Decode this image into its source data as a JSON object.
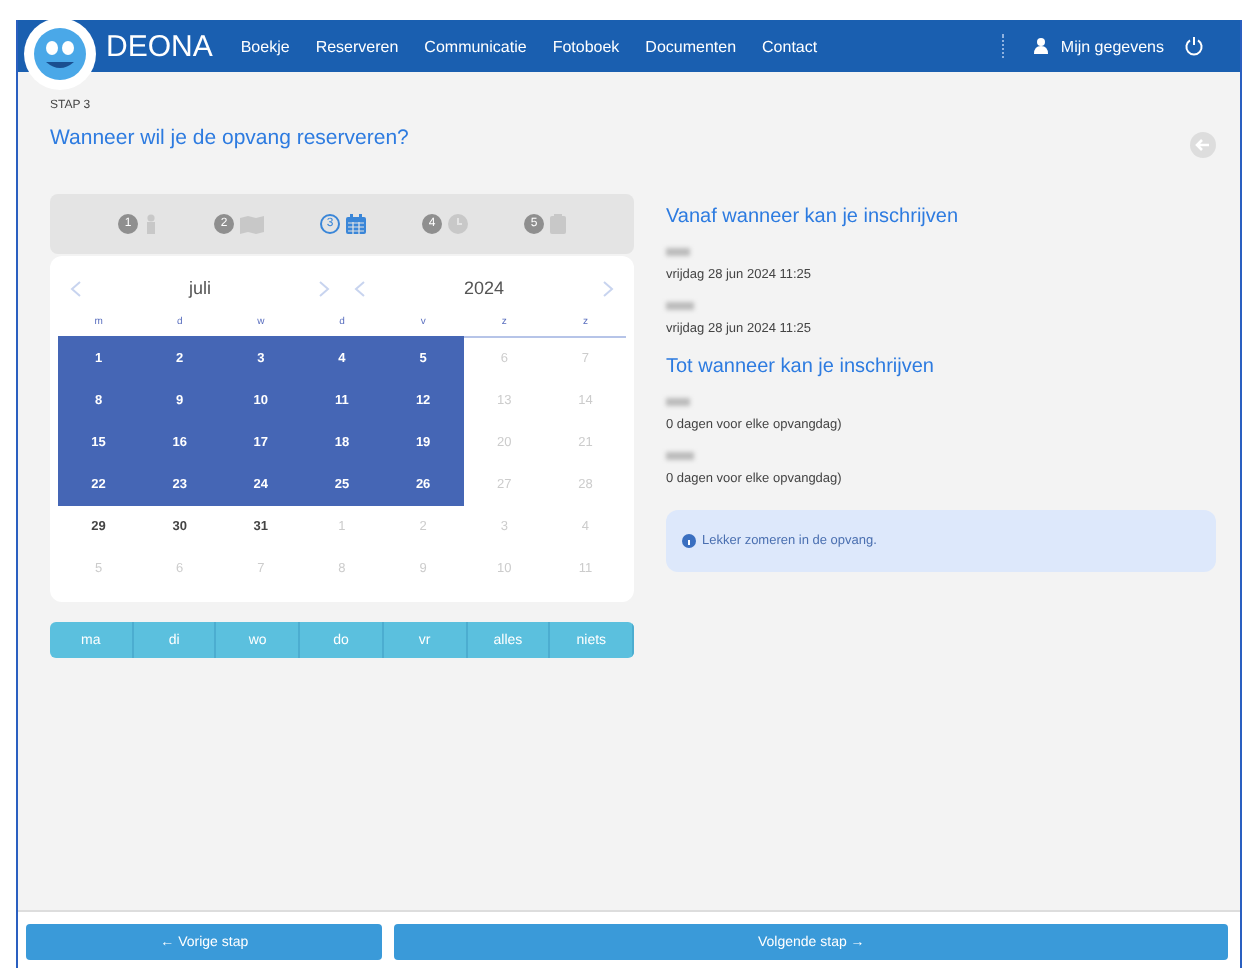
{
  "header": {
    "brand": "DEONA",
    "nav": [
      "Boekje",
      "Reserveren",
      "Communicatie",
      "Fotoboek",
      "Documenten",
      "Contact"
    ],
    "user": "Mijn gegevens"
  },
  "step_label": "STAP 3",
  "title": "Wanneer wil je de opvang reserveren?",
  "steps": [
    {
      "number": "1",
      "kind": "person",
      "selected": false
    },
    {
      "number": "2",
      "kind": "map",
      "selected": false
    },
    {
      "number": "3",
      "kind": "calendar",
      "selected": true
    },
    {
      "number": "4",
      "kind": "clock",
      "selected": false
    },
    {
      "number": "5",
      "kind": "clipboard",
      "selected": false
    }
  ],
  "calendar": {
    "month": "juli",
    "year": "2024",
    "weekdays": [
      "m",
      "d",
      "w",
      "d",
      "v",
      "z",
      "z"
    ],
    "weeks": [
      [
        {
          "day": "1",
          "kind": "selected"
        },
        {
          "day": "2",
          "kind": "selected"
        },
        {
          "day": "3",
          "kind": "selected"
        },
        {
          "day": "4",
          "kind": "selected"
        },
        {
          "day": "5",
          "kind": "selected"
        },
        {
          "day": "6",
          "kind": "disabled"
        },
        {
          "day": "7",
          "kind": "disabled"
        }
      ],
      [
        {
          "day": "8",
          "kind": "selected"
        },
        {
          "day": "9",
          "kind": "selected"
        },
        {
          "day": "10",
          "kind": "selected"
        },
        {
          "day": "11",
          "kind": "selected"
        },
        {
          "day": "12",
          "kind": "selected"
        },
        {
          "day": "13",
          "kind": "disabled"
        },
        {
          "day": "14",
          "kind": "disabled"
        }
      ],
      [
        {
          "day": "15",
          "kind": "selected"
        },
        {
          "day": "16",
          "kind": "selected"
        },
        {
          "day": "17",
          "kind": "selected"
        },
        {
          "day": "18",
          "kind": "selected"
        },
        {
          "day": "19",
          "kind": "selected"
        },
        {
          "day": "20",
          "kind": "disabled"
        },
        {
          "day": "21",
          "kind": "disabled"
        }
      ],
      [
        {
          "day": "22",
          "kind": "selected"
        },
        {
          "day": "23",
          "kind": "selected"
        },
        {
          "day": "24",
          "kind": "selected"
        },
        {
          "day": "25",
          "kind": "selected"
        },
        {
          "day": "26",
          "kind": "selected"
        },
        {
          "day": "27",
          "kind": "disabled"
        },
        {
          "day": "28",
          "kind": "disabled"
        }
      ],
      [
        {
          "day": "29",
          "kind": "available"
        },
        {
          "day": "30",
          "kind": "available"
        },
        {
          "day": "31",
          "kind": "available"
        },
        {
          "day": "1",
          "kind": "disabled"
        },
        {
          "day": "2",
          "kind": "disabled"
        },
        {
          "day": "3",
          "kind": "disabled"
        },
        {
          "day": "4",
          "kind": "disabled"
        }
      ],
      [
        {
          "day": "5",
          "kind": "disabled"
        },
        {
          "day": "6",
          "kind": "disabled"
        },
        {
          "day": "7",
          "kind": "disabled"
        },
        {
          "day": "8",
          "kind": "disabled"
        },
        {
          "day": "9",
          "kind": "disabled"
        },
        {
          "day": "10",
          "kind": "disabled"
        },
        {
          "day": "11",
          "kind": "disabled"
        }
      ]
    ]
  },
  "day_buttons": [
    "ma",
    "di",
    "wo",
    "do",
    "vr",
    "alles",
    "niets"
  ],
  "sections": [
    {
      "heading": "Vanaf wanneer kan je inschrijven",
      "entries": [
        "vrijdag 28 jun 2024 11:25",
        "vrijdag 28 jun 2024 11:25"
      ]
    },
    {
      "heading": "Tot wanneer kan je inschrijven",
      "entries": [
        "0 dagen voor elke opvangdag)",
        "0 dagen voor elke opvangdag)"
      ]
    }
  ],
  "notice": "Lekker zomeren in de opvang.",
  "footer": {
    "previous": "← Vorige stap",
    "next": "Volgende stap →"
  }
}
